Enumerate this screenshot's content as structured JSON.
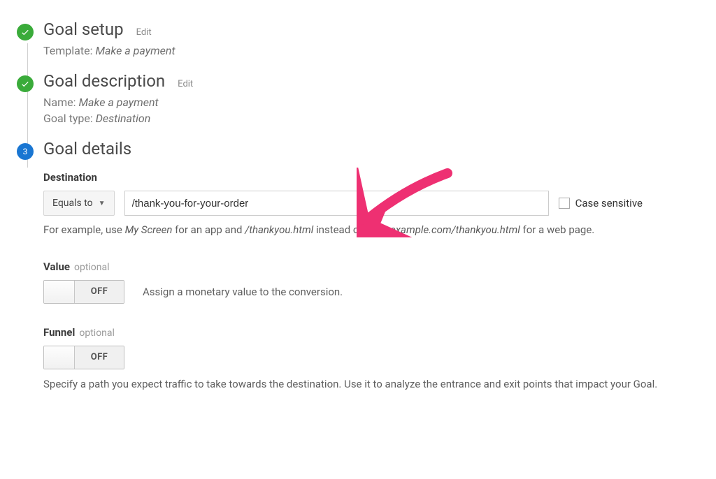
{
  "steps": {
    "setup": {
      "title": "Goal setup",
      "edit": "Edit",
      "template_label": "Template:",
      "template_value": "Make a payment"
    },
    "description": {
      "title": "Goal description",
      "edit": "Edit",
      "name_label": "Name:",
      "name_value": "Make a payment",
      "type_label": "Goal type:",
      "type_value": "Destination"
    },
    "details": {
      "number": "3",
      "title": "Goal details"
    }
  },
  "destination": {
    "label": "Destination",
    "dropdown": "Equals to",
    "value": "/thank-you-for-your-order",
    "case_label": "Case sensitive",
    "hint_prefix": "For example, use ",
    "hint_em1": "My Screen",
    "hint_mid1": " for an app and ",
    "hint_em2": "/thankyou.html",
    "hint_mid2": " instead of ",
    "hint_em3": "www.example.com/thankyou.html",
    "hint_suffix": " for a web page."
  },
  "value": {
    "label": "Value",
    "optional": "optional",
    "state": "OFF",
    "desc": "Assign a monetary value to the conversion."
  },
  "funnel": {
    "label": "Funnel",
    "optional": "optional",
    "state": "OFF",
    "desc": "Specify a path you expect traffic to take towards the destination. Use it to analyze the entrance and exit points that impact your Goal."
  }
}
